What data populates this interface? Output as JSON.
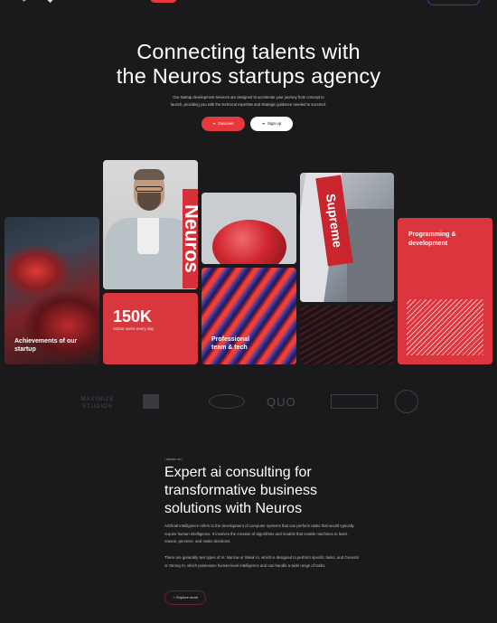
{
  "nav": {
    "links": [
      "",
      "",
      "",
      "",
      "",
      ""
    ]
  },
  "hero": {
    "title_line1": "Connecting talents with",
    "title_line2": "the Neuros startups agency",
    "subtitle_line1": "Our startup development services are designed to accelerate your journey from concept to",
    "subtitle_line2": "launch, providing you with the technical expertise and strategic guidance needed to succeed.",
    "discover_label": "Discover",
    "signup_label": "Sign up"
  },
  "cards": {
    "achievements": "Achievements of our startup",
    "brand_text": "Neuros",
    "stat_value": "150K",
    "stat_label": "Active users every day",
    "tech_label": "Professional team & tech",
    "supreme_text": "Supreme",
    "programming_label": "Programming & development"
  },
  "partners": [
    "MAXIMIZE STUDIOS",
    "",
    "",
    "QUO",
    "",
    ""
  ],
  "about": {
    "tag": "/ about us /",
    "title_line1": "Expert ai consulting for",
    "title_line2": "transformative business",
    "title_line3": "solutions with Neuros",
    "paragraph1": "Artificial Intelligence refers to the development of computer systems that can perform tasks that would typically require human intelligence. It involves the creation of algorithms and models that enable machines to learn, reason, perceive, and make decisions.",
    "paragraph2": "There are generally two types of AI: Narrow or Weak AI, which is designed to perform specific tasks, and General or Strong AI, which possesses human-level intelligence and can handle a wide range of tasks.",
    "explore_label": "Explore more"
  },
  "colors": {
    "accent": "#e5393d",
    "background": "#1a1a1c"
  }
}
